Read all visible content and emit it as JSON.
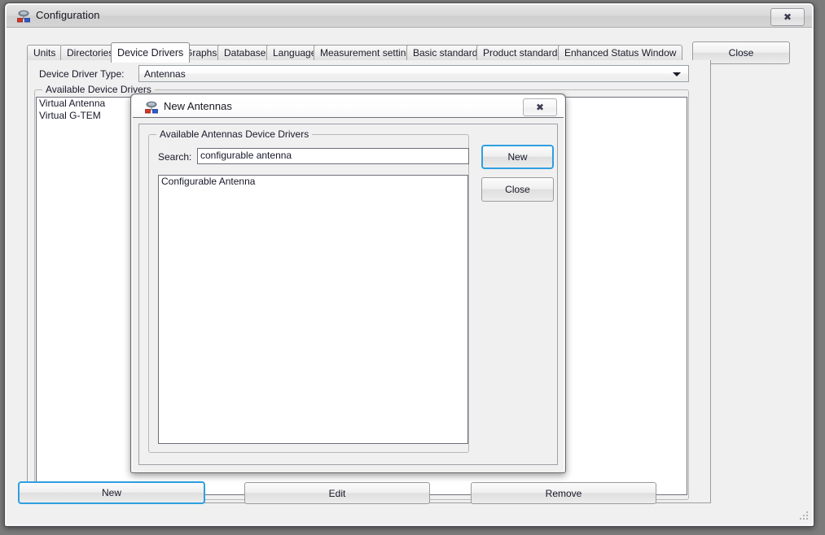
{
  "window": {
    "title": "Configuration",
    "icon": "device-network-icon",
    "close_glyph": "✖"
  },
  "tabs": [
    {
      "label": "Units",
      "selected": false
    },
    {
      "label": "Directories",
      "selected": false
    },
    {
      "label": "Device Drivers",
      "selected": true
    },
    {
      "label": "Graphs",
      "selected": false
    },
    {
      "label": "Database",
      "selected": false
    },
    {
      "label": "Language",
      "selected": false
    },
    {
      "label": "Measurement settings",
      "selected": false
    },
    {
      "label": "Basic standards",
      "selected": false
    },
    {
      "label": "Product standards",
      "selected": false
    },
    {
      "label": "Enhanced Status Window",
      "selected": false
    }
  ],
  "main": {
    "close_button": "Close",
    "driver_type_label": "Device Driver Type:",
    "driver_type_value": "Antennas",
    "group_title": "Available Device Drivers",
    "drivers": [
      "Virtual Antenna",
      "Virtual G-TEM"
    ],
    "buttons": {
      "new": "New",
      "edit": "Edit",
      "remove": "Remove"
    }
  },
  "dialog": {
    "title": "New Antennas",
    "icon": "device-network-icon",
    "close_glyph": "✖",
    "group_title": "Available Antennas Device Drivers",
    "search_label": "Search:",
    "search_value": "configurable antenna",
    "search_placeholder": "",
    "results": [
      "Configurable Antenna"
    ],
    "buttons": {
      "new": "New",
      "close": "Close"
    }
  },
  "colors": {
    "focus_blue": "#2f9fe0",
    "window_bg": "#f0f0f0",
    "field_bg": "#ffffff",
    "text": "#18182a"
  }
}
